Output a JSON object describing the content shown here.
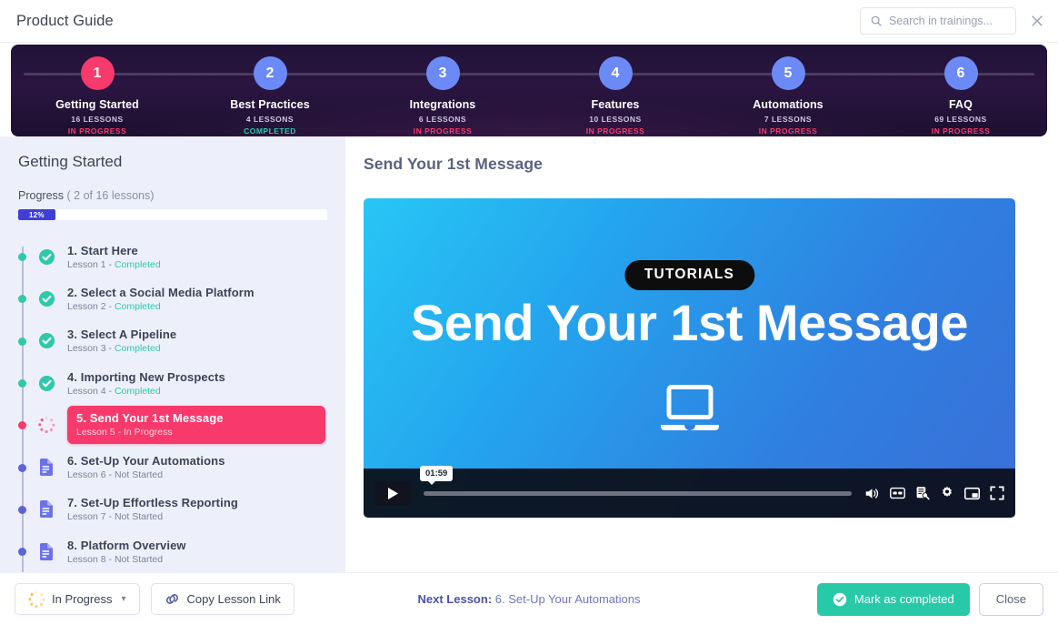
{
  "header": {
    "title": "Product Guide",
    "search": {
      "placeholder": "Search in trainings...",
      "value": "",
      "icon": "search-icon"
    },
    "close_icon": "close-icon"
  },
  "stepper": {
    "steps": [
      {
        "number": "1",
        "name": "Getting Started",
        "lessons": "16 LESSONS",
        "status": "IN PROGRESS",
        "circle_color": "#f8396b",
        "status_color": "#f8396b",
        "active": true
      },
      {
        "number": "2",
        "name": "Best Practices",
        "lessons": "4 LESSONS",
        "status": "COMPLETED",
        "circle_color": "#6b8af6",
        "status_color": "#2ec9aa",
        "active": false
      },
      {
        "number": "3",
        "name": "Integrations",
        "lessons": "6 LESSONS",
        "status": "IN PROGRESS",
        "circle_color": "#6b8af6",
        "status_color": "#f8396b",
        "active": false
      },
      {
        "number": "4",
        "name": "Features",
        "lessons": "10 LESSONS",
        "status": "IN PROGRESS",
        "circle_color": "#6b8af6",
        "status_color": "#f8396b",
        "active": false
      },
      {
        "number": "5",
        "name": "Automations",
        "lessons": "7 LESSONS",
        "status": "IN PROGRESS",
        "circle_color": "#6b8af6",
        "status_color": "#f8396b",
        "active": false
      },
      {
        "number": "6",
        "name": "FAQ",
        "lessons": "69 LESSONS",
        "status": "IN PROGRESS",
        "circle_color": "#6b8af6",
        "status_color": "#f8396b",
        "active": false
      }
    ]
  },
  "sidebar": {
    "title": "Getting Started",
    "progress_label_bold": "Progress",
    "progress_label_rest": " ( 2 of 16 lessons)",
    "progress_percent_text": "12%",
    "progress_percent_value": 12,
    "progress_fill_color": "#3f3fd8",
    "lessons": [
      {
        "title": "1. Start Here",
        "sub_prefix": "Lesson 1 - ",
        "status": "Completed",
        "state": "completed",
        "icon": "check-circle-icon",
        "dot_color": "#2ec9aa"
      },
      {
        "title": "2. Select a Social Media Platform",
        "sub_prefix": "Lesson 2 - ",
        "status": "Completed",
        "state": "completed",
        "icon": "check-circle-icon",
        "dot_color": "#2ec9aa"
      },
      {
        "title": "3. Select A Pipeline",
        "sub_prefix": "Lesson 3 - ",
        "status": "Completed",
        "state": "completed",
        "icon": "check-circle-icon",
        "dot_color": "#2ec9aa"
      },
      {
        "title": "4. Importing New Prospects",
        "sub_prefix": "Lesson 4 - ",
        "status": "Completed",
        "state": "completed",
        "icon": "check-circle-icon",
        "dot_color": "#2ec9aa"
      },
      {
        "title": "5. Send Your 1st Message",
        "sub_prefix": "Lesson 5 - ",
        "status": "In Progress",
        "state": "active",
        "icon": "spinner-dots-icon",
        "dot_color": "#f8396b"
      },
      {
        "title": "6. Set-Up Your Automations",
        "sub_prefix": "Lesson 6 - ",
        "status": "Not Started",
        "state": "notstarted",
        "icon": "document-icon",
        "dot_color": "#5c63d8"
      },
      {
        "title": "7. Set-Up Effortless Reporting",
        "sub_prefix": "Lesson 7 - ",
        "status": "Not Started",
        "state": "notstarted",
        "icon": "document-icon",
        "dot_color": "#5c63d8"
      },
      {
        "title": "8. Platform Overview",
        "sub_prefix": "Lesson 8 - ",
        "status": "Not Started",
        "state": "notstarted",
        "icon": "document-icon",
        "dot_color": "#5c63d8"
      }
    ]
  },
  "main": {
    "lesson_heading": "Send Your 1st Message",
    "video": {
      "badge": "TUTORIALS",
      "title": "Send Your 1st Message",
      "thumbnail_icon": "laptop-icon",
      "play_icon": "play-icon",
      "time_tooltip": "01:59",
      "scrub_percent": 0,
      "controls": [
        {
          "icon": "volume-icon"
        },
        {
          "icon": "closed-captions-icon"
        },
        {
          "icon": "transcript-search-icon"
        },
        {
          "icon": "settings-gear-icon"
        },
        {
          "icon": "picture-in-picture-icon"
        },
        {
          "icon": "fullscreen-icon"
        }
      ]
    }
  },
  "bottombar": {
    "status_button": {
      "label": "In Progress",
      "icon": "spinner-dots-icon",
      "chevron": "chevron-down-icon"
    },
    "copy_button": {
      "label": "Copy Lesson Link",
      "icon": "link-icon"
    },
    "next_lesson_label": "Next Lesson:",
    "next_lesson_value": " 6. Set-Up Your Automations",
    "mark_completed": {
      "label": "Mark as completed",
      "icon": "check-circle-icon",
      "color": "#28c9a8"
    },
    "close": {
      "label": "Close"
    }
  }
}
